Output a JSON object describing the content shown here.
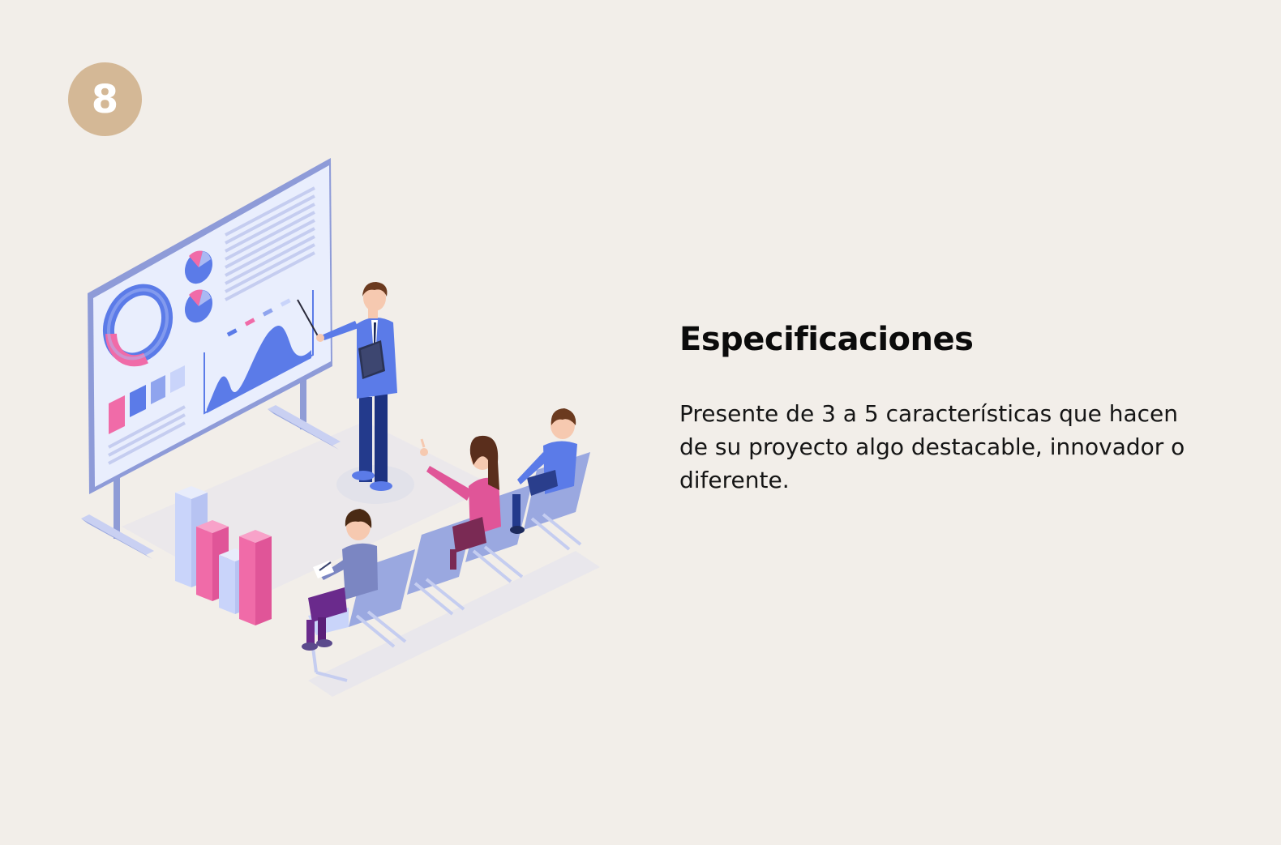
{
  "slide": {
    "page_number": "8",
    "title": "Especificaciones",
    "description": "Presente de 3 a 5 características que hacen de su proyecto algo destacable, innovador o diferente."
  },
  "colors": {
    "background": "#F2EEE9",
    "badge": "#D4B896",
    "accent_blue": "#5B7BE8",
    "accent_pink": "#F06BA8",
    "board": "#E8EDFD"
  },
  "illustration": {
    "icon": "presentation-illustration"
  }
}
